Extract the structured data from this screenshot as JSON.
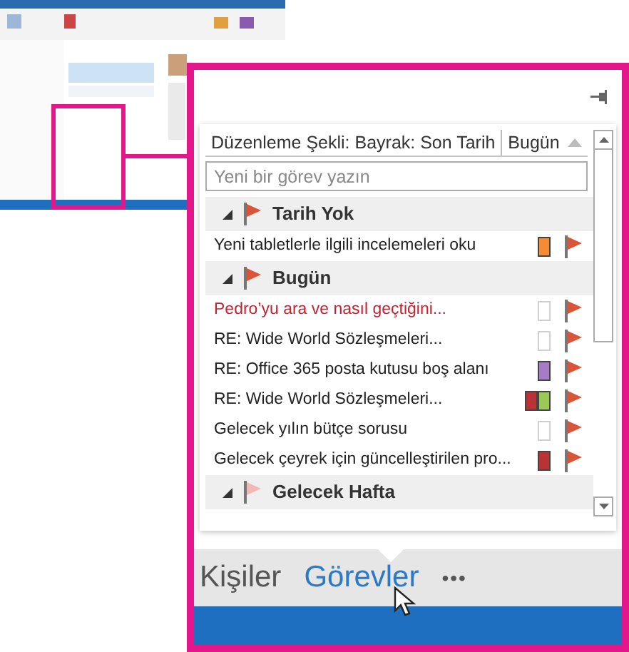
{
  "tasks_peek": {
    "arrange_label": "Düzenleme Şekli: Bayrak: Son Tarih",
    "sort_label": "Bugün",
    "new_task": {
      "placeholder": "Yeni bir görev yazın"
    },
    "groups": [
      {
        "title": "Tarih Yok",
        "expanded": true,
        "color": "#d9553a",
        "items": [
          {
            "title": "Yeni tabletlerle ilgili incelemeleri oku",
            "overdue": false,
            "categories": [
              {
                "color": "#f68b35"
              }
            ]
          }
        ]
      },
      {
        "title": "Bugün",
        "expanded": true,
        "color": "#d9553a",
        "items": [
          {
            "title": "Pedro’yu ara ve nasıl geçtiğini...",
            "overdue": true
          },
          {
            "title": "RE: Wide World Sözleşmeleri...",
            "overdue": false
          },
          {
            "title": "RE: Office 365 posta kutusu boş alanı",
            "overdue": false,
            "categories": [
              {
                "color": "#a77cc6"
              }
            ]
          },
          {
            "title": "RE: Wide World Sözleşmeleri...",
            "overdue": false,
            "categories": [
              {
                "color": "#b83236"
              },
              {
                "color": "#9bc957"
              }
            ]
          },
          {
            "title": "Gelecek yılın bütçe sorusu",
            "overdue": false
          },
          {
            "title": "Gelecek çeyrek için güncelleştirilen pro...",
            "overdue": false,
            "categories": [
              {
                "color": "#b83236"
              }
            ]
          }
        ]
      },
      {
        "title": "Gelecek Hafta",
        "expanded": true,
        "color": "#f2b8b4"
      }
    ]
  },
  "navigation": {
    "items": [
      {
        "label": "Kişiler",
        "selected": false
      },
      {
        "label": "Görevler",
        "selected": true
      }
    ],
    "more": "•••"
  }
}
